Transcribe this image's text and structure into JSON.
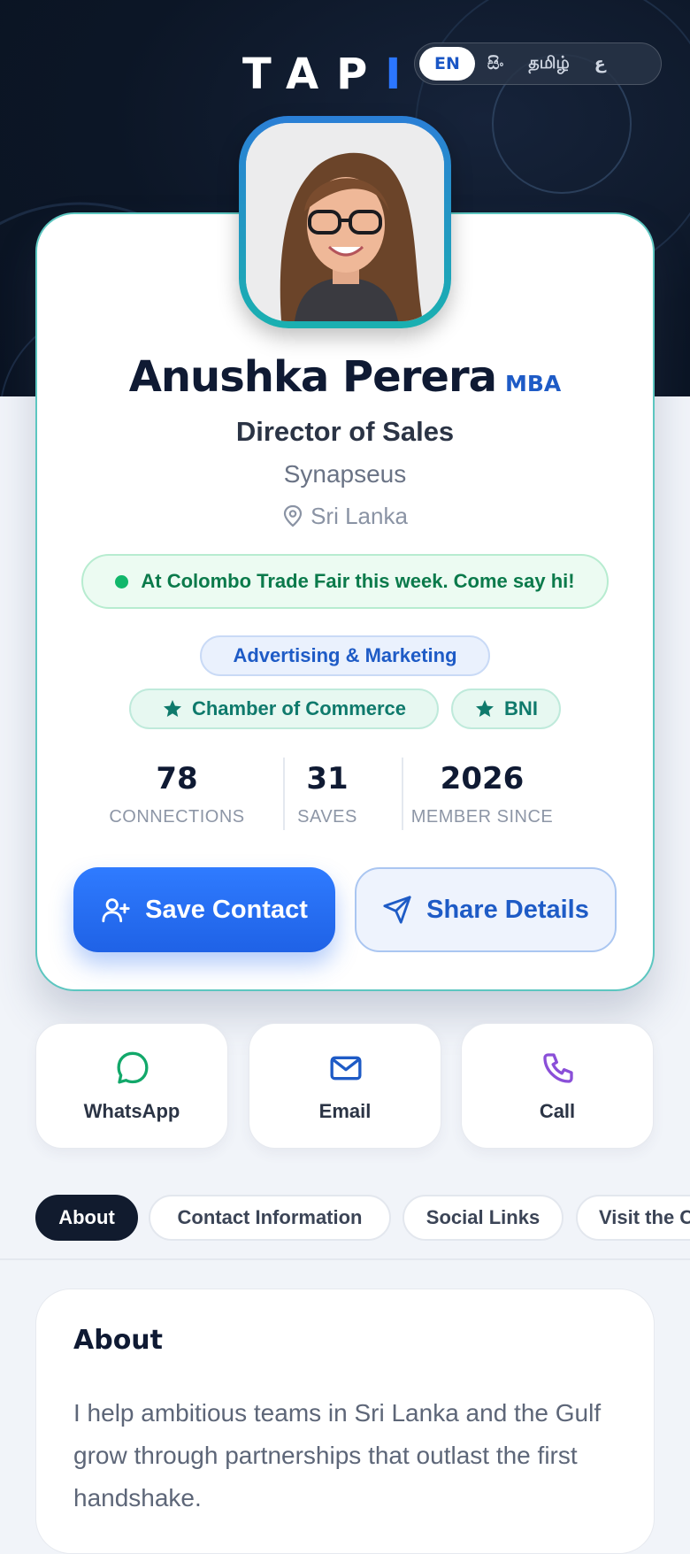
{
  "header": {
    "logo_main": "TAP",
    "logo_accent": "I",
    "languages": [
      {
        "label": "EN",
        "active": true
      },
      {
        "label": "සිං",
        "active": false
      },
      {
        "label": "தமிழ்",
        "active": false
      },
      {
        "label": "ع",
        "active": false
      }
    ]
  },
  "profile": {
    "name": "Anushka Perera",
    "credential": "MBA",
    "title": "Director of Sales",
    "company": "Synapseus",
    "location": "Sri Lanka",
    "status": "At Colombo Trade Fair this week. Come say hi!",
    "industry": "Advertising & Marketing",
    "organizations": [
      "Chamber of Commerce",
      "BNI"
    ],
    "stats": [
      {
        "value": "78",
        "label": "CONNECTIONS"
      },
      {
        "value": "31",
        "label": "SAVES"
      },
      {
        "value": "2026",
        "label": "MEMBER SINCE"
      }
    ],
    "save_label": "Save Contact",
    "share_label": "Share Details"
  },
  "quick_actions": [
    {
      "label": "WhatsApp",
      "icon": "whatsapp-icon",
      "color": "#12a86a"
    },
    {
      "label": "Email",
      "icon": "mail-icon",
      "color": "#1e5bc6"
    },
    {
      "label": "Call",
      "icon": "phone-icon",
      "color": "#8a4fd8"
    }
  ],
  "tabs": [
    {
      "label": "About",
      "active": true
    },
    {
      "label": "Contact Information",
      "active": false
    },
    {
      "label": "Social Links",
      "active": false
    },
    {
      "label": "Visit the C",
      "active": false
    }
  ],
  "about": {
    "heading": "About",
    "text": "I help ambitious teams in Sri Lanka and the Gulf grow through partnerships that outlast the first handshake."
  },
  "colors": {
    "hero_bg": "#0c1626",
    "brand_blue": "#2b76ff",
    "teal_border": "#5cc6c0",
    "status_green": "#11b76b"
  }
}
